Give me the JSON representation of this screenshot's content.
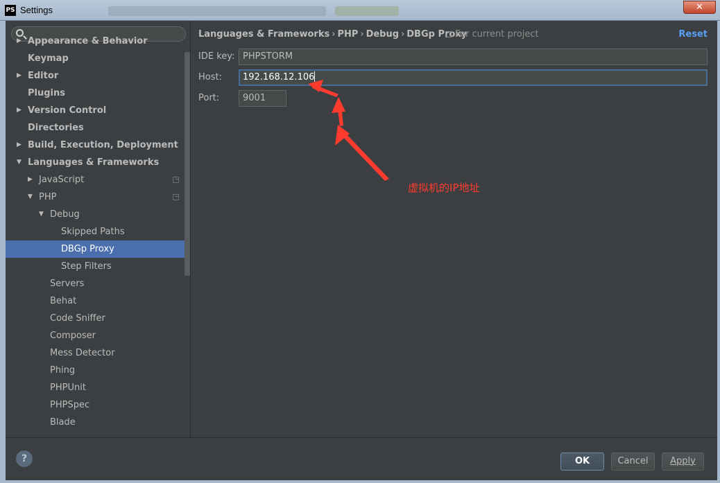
{
  "window": {
    "app_icon": "PS",
    "title": "Settings",
    "close_glyph": "✕"
  },
  "sidebar": {
    "search_placeholder": "",
    "items": [
      {
        "label": "Appearance & Behavior",
        "arrow": "▶",
        "bold": true
      },
      {
        "label": "Keymap",
        "arrow": "",
        "bold": true
      },
      {
        "label": "Editor",
        "arrow": "▶",
        "bold": true
      },
      {
        "label": "Plugins",
        "arrow": "",
        "bold": true
      },
      {
        "label": "Version Control",
        "arrow": "▶",
        "bold": true
      },
      {
        "label": "Directories",
        "arrow": "",
        "bold": true
      },
      {
        "label": "Build, Execution, Deployment",
        "arrow": "▶",
        "bold": true
      },
      {
        "label": "Languages & Frameworks",
        "arrow": "▼",
        "bold": true
      },
      {
        "label": "JavaScript",
        "arrow": "▶",
        "bold": false
      },
      {
        "label": "PHP",
        "arrow": "▼",
        "bold": false
      },
      {
        "label": "Debug",
        "arrow": "▼",
        "bold": false
      },
      {
        "label": "Skipped Paths",
        "arrow": "",
        "bold": false
      },
      {
        "label": "DBGp Proxy",
        "arrow": "",
        "bold": false,
        "selected": true
      },
      {
        "label": "Step Filters",
        "arrow": "",
        "bold": false
      },
      {
        "label": "Servers",
        "arrow": "",
        "bold": false
      },
      {
        "label": "Behat",
        "arrow": "",
        "bold": false
      },
      {
        "label": "Code Sniffer",
        "arrow": "",
        "bold": false
      },
      {
        "label": "Composer",
        "arrow": "",
        "bold": false
      },
      {
        "label": "Mess Detector",
        "arrow": "",
        "bold": false
      },
      {
        "label": "Phing",
        "arrow": "",
        "bold": false
      },
      {
        "label": "PHPUnit",
        "arrow": "",
        "bold": false
      },
      {
        "label": "PHPSpec",
        "arrow": "",
        "bold": false
      },
      {
        "label": "Blade",
        "arrow": "",
        "bold": false
      }
    ]
  },
  "main": {
    "breadcrumb": [
      "Languages & Frameworks",
      "PHP",
      "Debug",
      "DBGp Proxy"
    ],
    "breadcrumb_sep": "›",
    "scope_note": "For current project",
    "reset_label": "Reset",
    "fields": {
      "ide_key": {
        "label": "IDE key:",
        "value": "PHPSTORM"
      },
      "host": {
        "label": "Host:",
        "value": "192.168.12.106"
      },
      "port": {
        "label": "Port:",
        "value": "9001"
      }
    },
    "annotation": "虚拟机的IP地址",
    "annotation_color": "#ff3b30"
  },
  "footer": {
    "help": "?",
    "ok_label": "OK",
    "cancel_label": "Cancel",
    "apply_label": "Apply"
  },
  "colors": {
    "background": "#3c3f41",
    "selection": "#4b6eaf",
    "link": "#589df6"
  }
}
